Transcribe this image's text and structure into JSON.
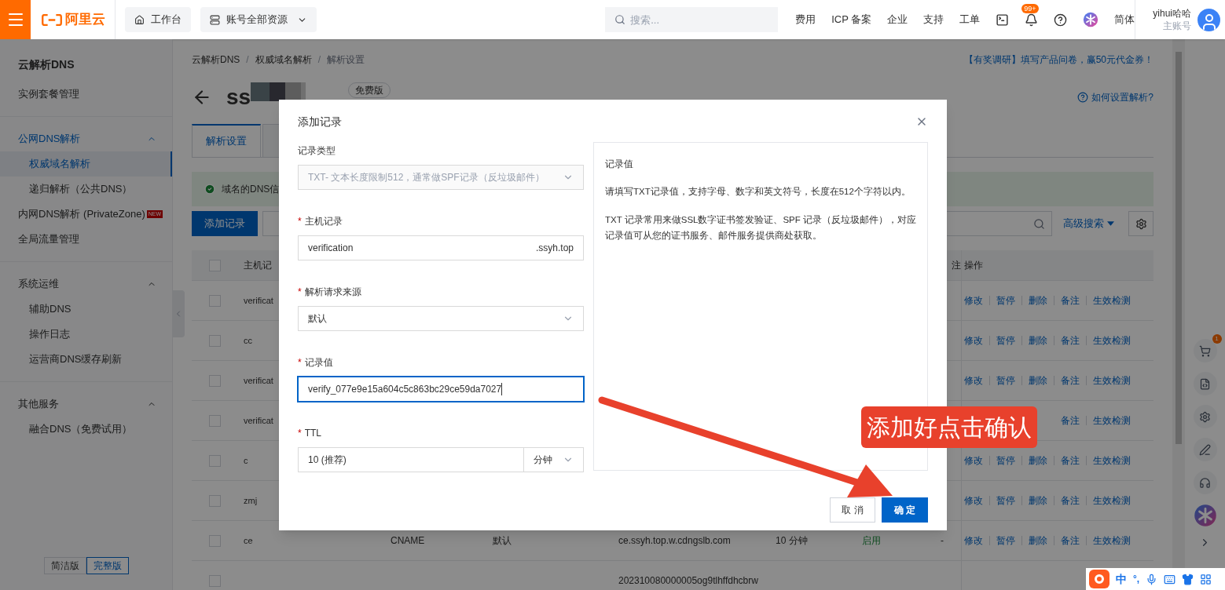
{
  "topbar": {
    "logo": "阿里云",
    "workbench": "工作台",
    "resources": "账号全部资源",
    "search_placeholder": "搜索...",
    "links": [
      "费用",
      "ICP 备案",
      "企业",
      "支持",
      "工单"
    ],
    "notification_badge": "99+",
    "language": "简体",
    "user": {
      "name": "yihui哈哈",
      "role": "主账号"
    }
  },
  "sidebar": {
    "title": "云解析DNS",
    "items": [
      {
        "kind": "link",
        "label": "实例套餐管理",
        "selected": false
      },
      {
        "kind": "divider"
      },
      {
        "kind": "group",
        "label": "公网DNS解析",
        "expanded": true,
        "active": true,
        "children": [
          {
            "kind": "link",
            "label": "权威域名解析",
            "selected": true
          },
          {
            "kind": "link",
            "label": "递归解析（公共DNS）",
            "selected": false
          }
        ]
      },
      {
        "kind": "link",
        "label": "内网DNS解析 (PrivateZone)",
        "badge": "NEW",
        "selected": false
      },
      {
        "kind": "link",
        "label": "全局流量管理",
        "selected": false
      },
      {
        "kind": "divider"
      },
      {
        "kind": "group",
        "label": "系统运维",
        "expanded": true,
        "active": false,
        "children": [
          {
            "kind": "link",
            "label": "辅助DNS",
            "selected": false
          },
          {
            "kind": "link",
            "label": "操作日志",
            "selected": false
          },
          {
            "kind": "link",
            "label": "运营商DNS缓存刷新",
            "selected": false
          }
        ]
      },
      {
        "kind": "divider"
      },
      {
        "kind": "group",
        "label": "其他服务",
        "expanded": true,
        "active": false,
        "children": [
          {
            "kind": "link",
            "label": "融合DNS（免费试用）",
            "selected": false
          }
        ]
      }
    ],
    "view_toggle": [
      {
        "label": "简洁版",
        "selected": false
      },
      {
        "label": "完整版",
        "selected": true
      }
    ]
  },
  "main": {
    "breadcrumb": [
      {
        "kind": "link",
        "text": "云解析DNS"
      },
      {
        "kind": "separator",
        "text": "/"
      },
      {
        "kind": "link",
        "text": "权威域名解析"
      },
      {
        "kind": "separator",
        "text": "/"
      },
      {
        "kind": "current",
        "text": "解析设置"
      }
    ],
    "survey_link": "【有奖调研】填写产品问卷，赢50元代金券！",
    "title": "ss",
    "plan_badge": "免费版",
    "help_link": "如何设置解析?",
    "tabs": [
      {
        "label": "解析设置",
        "selected": true
      },
      {
        "selected": false
      }
    ],
    "alert": "域名的DNS信",
    "add_button": "添加记录",
    "advanced_search": "高级搜索",
    "table": {
      "select_all_checked": false,
      "columns": [
        "主机记",
        "注",
        "操作"
      ],
      "rows": [
        {
          "checked": false,
          "host": "verificat",
          "actions": [
            "修改",
            "暂停",
            "删除",
            "备注",
            "生效检测"
          ]
        },
        {
          "checked": false,
          "host": "cc",
          "actions": [
            "修改",
            "暂停",
            "删除",
            "备注",
            "生效检测"
          ]
        },
        {
          "checked": false,
          "host": "verificat",
          "actions": [
            "修改",
            "暂停",
            "删除",
            "备注",
            "生效检测"
          ]
        },
        {
          "checked": false,
          "host": "verificat",
          "actions": [
            "备注",
            "生效检测"
          ]
        },
        {
          "checked": false,
          "host": "c",
          "actions": [
            "修改",
            "暂停",
            "删除",
            "备注",
            "生效检测"
          ]
        },
        {
          "checked": false,
          "host": "zmj",
          "actions": [
            "修改",
            "暂停",
            "删除",
            "备注",
            "生效检测"
          ]
        },
        {
          "checked": false,
          "host": "ce",
          "type": "CNAME",
          "line": "默认",
          "value": "ce.ssyh.top.w.cdngslb.com",
          "ttl": "10 分钟",
          "status": "启用",
          "remark": "-",
          "actions": [
            "修改",
            "暂停",
            "删除",
            "备注",
            "生效检测"
          ]
        },
        {
          "checked": false,
          "value": "202310080000005og9tlhffdhcbrw"
        }
      ]
    }
  },
  "dialog": {
    "title": "添加记录",
    "fields": [
      {
        "kind": "select",
        "label": "记录类型",
        "disabled": true,
        "value": "TXT- 文本长度限制512，通常做SPF记录（反垃圾邮件）"
      },
      {
        "kind": "input",
        "label": "主机记录",
        "required_mark": "*",
        "focused": false,
        "value": "verification",
        "suffix": ".ssyh.top"
      },
      {
        "kind": "select",
        "label": "解析请求来源",
        "required_mark": "*",
        "disabled": false,
        "value": "默认"
      },
      {
        "kind": "input",
        "label": "记录值",
        "required_mark": "*",
        "focused": true,
        "value": "verify_077e9e15a604c5c863bc29ce59da7027"
      },
      {
        "kind": "ttl",
        "label": "TTL",
        "required_mark": "*",
        "value": "10 (推荐)",
        "unit": "分钟"
      }
    ],
    "help": {
      "title": "记录值",
      "paragraphs": [
        "请填写TXT记录值，支持字母、数字和英文符号，长度在512个字符以内。",
        "TXT 记录常用来做SSL数字证书签发验证、SPF 记录（反垃圾邮件），对应记录值可从您的证书服务、邮件服务提供商处获取。"
      ]
    },
    "cancel": "取 消",
    "confirm": "确 定"
  },
  "annotation": {
    "text": "添加好点击确认"
  },
  "side_tools": {
    "cart_badge": "1"
  },
  "ime_bar": {
    "mode": "中",
    "punct": "°,"
  }
}
